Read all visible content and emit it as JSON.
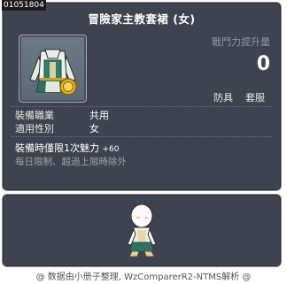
{
  "item_code": "01051804",
  "item": {
    "name": "冒險家主教套裙 (女)",
    "icon": "robe-icon"
  },
  "combat_power": {
    "label": "戰鬥力提升量",
    "value": "0"
  },
  "tags": [
    "防具",
    "套服"
  ],
  "requirements": [
    {
      "label": "裝備職業",
      "value": "共用"
    },
    {
      "label": "適用性別",
      "value": "女"
    }
  ],
  "equip_bonus": {
    "text": "裝備時僅限1次魅力",
    "value": "+60"
  },
  "limit_text": "每日限制、超過上限時除外",
  "footer": "@ 数据由小册子整理, WzComparerR2-NTMS解析 @"
}
